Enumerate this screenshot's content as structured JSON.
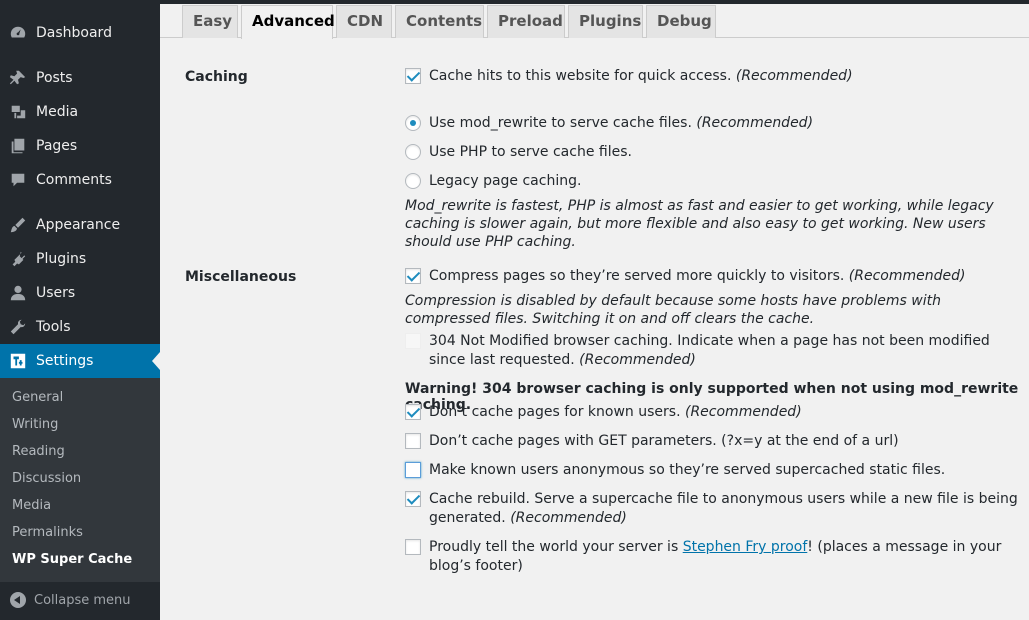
{
  "sidebar": {
    "items": [
      {
        "label": "Dashboard",
        "icon": "dashboard-icon"
      },
      {
        "label": "Posts",
        "icon": "pin-icon"
      },
      {
        "label": "Media",
        "icon": "media-icon"
      },
      {
        "label": "Pages",
        "icon": "pages-icon"
      },
      {
        "label": "Comments",
        "icon": "comment-icon"
      },
      {
        "label": "Appearance",
        "icon": "brush-icon"
      },
      {
        "label": "Plugins",
        "icon": "plug-icon"
      },
      {
        "label": "Users",
        "icon": "user-icon"
      },
      {
        "label": "Tools",
        "icon": "wrench-icon"
      },
      {
        "label": "Settings",
        "icon": "settings-icon"
      }
    ],
    "submenu": [
      "General",
      "Writing",
      "Reading",
      "Discussion",
      "Media",
      "Permalinks",
      "WP Super Cache"
    ],
    "collapse_label": "Collapse menu"
  },
  "tabs": [
    "Easy",
    "Advanced",
    "CDN",
    "Contents",
    "Preload",
    "Plugins",
    "Debug"
  ],
  "active_tab": "Advanced",
  "caching": {
    "title": "Caching",
    "cache_hits": {
      "text": "Cache hits to this website for quick access.",
      "rec": "(Recommended)",
      "checked": true
    },
    "mod_rewrite": {
      "text": "Use mod_rewrite to serve cache files.",
      "rec": "(Recommended)",
      "checked": true
    },
    "php": {
      "text": "Use PHP to serve cache files.",
      "checked": false
    },
    "legacy": {
      "text": "Legacy page caching.",
      "checked": false
    },
    "note": "Mod_rewrite is fastest, PHP is almost as fast and easier to get working, while legacy caching is slower again, but more flexible and also easy to get working. New users should use PHP caching."
  },
  "misc": {
    "title": "Miscellaneous",
    "compress": {
      "text": "Compress pages so they’re served more quickly to visitors.",
      "rec": "(Recommended)",
      "checked": true
    },
    "compress_note": "Compression is disabled by default because some hosts have problems with compressed files. Switching it on and off clears the cache.",
    "not_modified": {
      "text": "304 Not Modified browser caching. Indicate when a page has not been modified since last requested.",
      "rec": "(Recommended)",
      "checked": false
    },
    "warning": "Warning! 304 browser caching is only supported when not using mod_rewrite caching.",
    "known_users": {
      "text": "Don’t cache pages for known users.",
      "rec": "(Recommended)",
      "checked": true
    },
    "get_params": {
      "text": "Don’t cache pages with GET parameters. (?x=y at the end of a url)",
      "checked": false
    },
    "anonymous": {
      "text": "Make known users anonymous so they’re served supercached static files.",
      "checked": false
    },
    "rebuild": {
      "text": "Cache rebuild. Serve a supercache file to anonymous users while a new file is being generated.",
      "rec": "(Recommended)",
      "checked": true
    },
    "proud": {
      "text_before": "Proudly tell the world your server is ",
      "link": "Stephen Fry proof",
      "text_after": "! (places a message in your blog’s footer)",
      "checked": false
    }
  },
  "colors": {
    "sidebar_bg": "#23282d",
    "accent": "#0073aa",
    "submenu_bg": "#32373c",
    "check": "#1e8cbe"
  }
}
